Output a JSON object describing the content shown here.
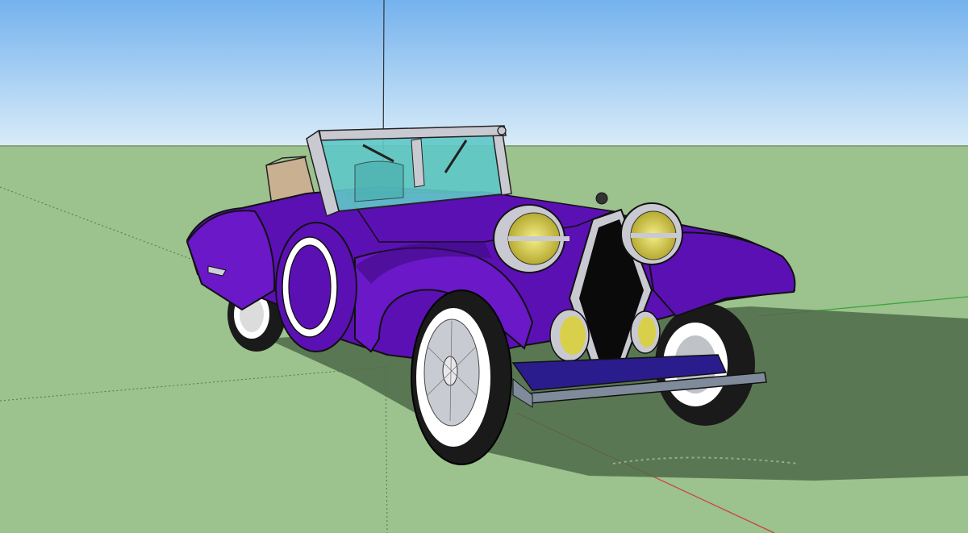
{
  "app": {
    "window_title": ""
  },
  "viewport": {
    "sky_top_color": "#74b2ee",
    "sky_bottom_color": "#d9ecf8",
    "ground_color": "#9cc28e",
    "horizon_line_color": "#8aa37e",
    "shadow_color": "#4f6a49"
  },
  "axes": {
    "red_axis_color": "#c8443b",
    "green_axis_color": "#38a838",
    "blue_axis_color": "#3b3ba4"
  },
  "model": {
    "body_color": "#5b10b4",
    "body_dark_color": "#3a0a7a",
    "trim_color": "#c9c9d2",
    "tire_color": "#1a1a1a",
    "whitewall_color": "#ffffff",
    "headlight_lens_color": "#d8d04a",
    "windshield_color": "#60c8c8",
    "luggage_color": "#c8b091",
    "bumper_color": "#7f8a9a",
    "grille_color": "#0a0a0a"
  }
}
